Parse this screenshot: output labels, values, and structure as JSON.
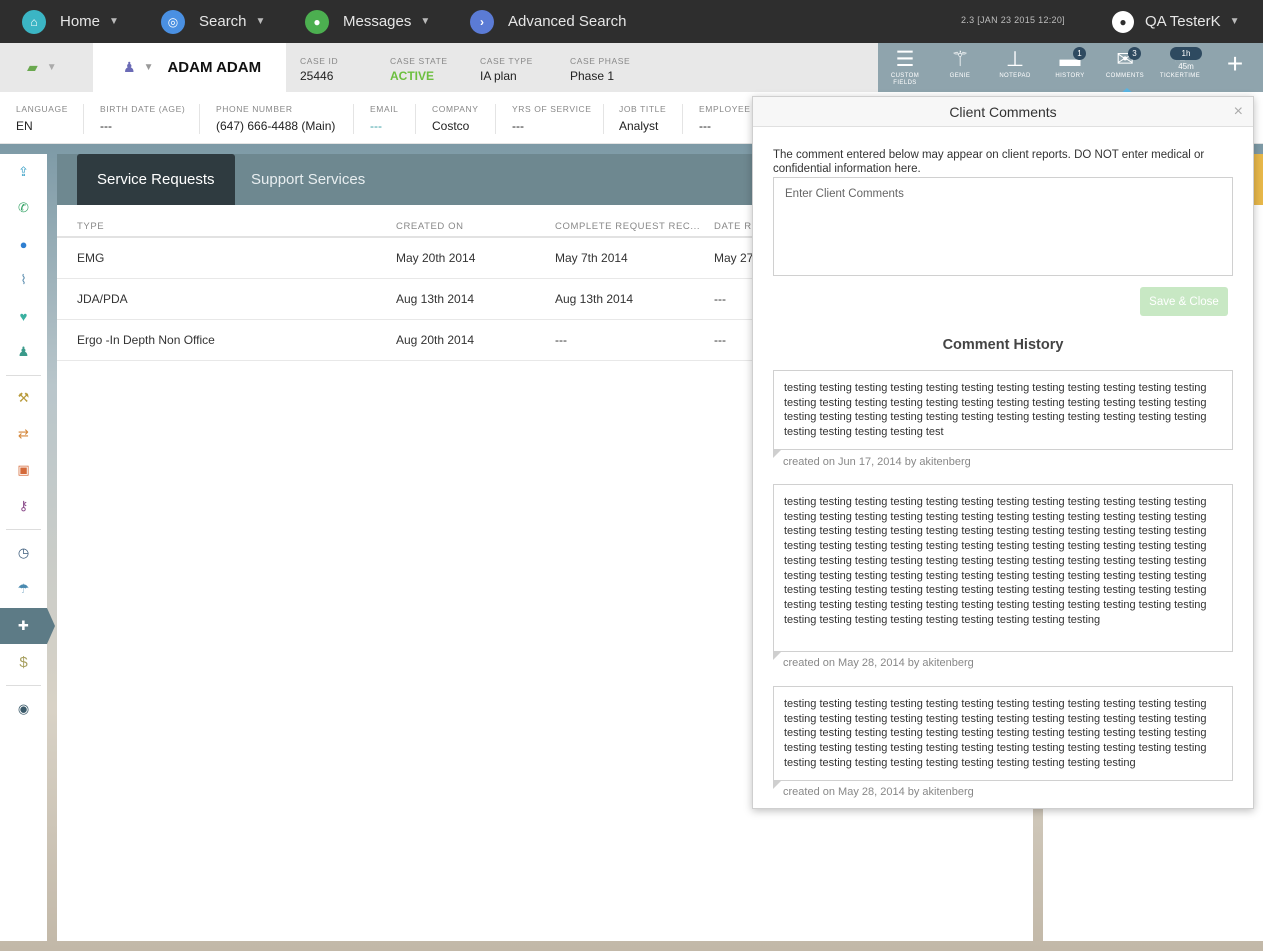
{
  "topnav": {
    "items": [
      {
        "label": "Home",
        "icon": "home-icon",
        "color": "#3bb5c4"
      },
      {
        "label": "Search",
        "icon": "search-icon",
        "color": "#4a90e2"
      },
      {
        "label": "Messages",
        "icon": "chat-icon",
        "color": "#4caf50"
      },
      {
        "label": "Advanced Search",
        "icon": "chevron-right-icon",
        "color": "#5b7bd5"
      }
    ],
    "version": "2.3 [JAN 23 2015 12:20]",
    "user": "QA TesterK"
  },
  "case": {
    "client_name": "ADAM ADAM",
    "fields": [
      {
        "label": "CASE ID",
        "value": "25446"
      },
      {
        "label": "CASE STATE",
        "value": "ACTIVE"
      },
      {
        "label": "CASE TYPE",
        "value": "IA plan"
      },
      {
        "label": "CASE PHASE",
        "value": "Phase 1"
      }
    ]
  },
  "toolbar": {
    "tools": [
      {
        "label": "CUSTOM FIELDS",
        "icon": "list-icon"
      },
      {
        "label": "GENIE",
        "icon": "wand-icon"
      },
      {
        "label": "NOTEPAD",
        "icon": "pin-icon"
      },
      {
        "label": "HISTORY",
        "icon": "folder-icon",
        "badge": "1"
      },
      {
        "label": "COMMENTS",
        "icon": "envelope-icon",
        "badge": "3"
      },
      {
        "label": "TICKERTIME",
        "icon": "timer-icon",
        "badge": "1h 45m"
      }
    ]
  },
  "info": {
    "fields": [
      {
        "label": "LANGUAGE",
        "value": "EN"
      },
      {
        "label": "BIRTH DATE (AGE)",
        "value": "---"
      },
      {
        "label": "PHONE NUMBER",
        "value": "(647) 666-4488 (Main)"
      },
      {
        "label": "EMAIL",
        "value": "---"
      },
      {
        "label": "COMPANY",
        "value": "Costco"
      },
      {
        "label": "YRS OF SERVICE",
        "value": "---"
      },
      {
        "label": "JOB TITLE",
        "value": "Analyst"
      },
      {
        "label": "EMPLOYEE I",
        "value": "---"
      }
    ]
  },
  "main": {
    "tabs": [
      "Service Requests",
      "Support Services"
    ],
    "columns": [
      "TYPE",
      "CREATED ON",
      "COMPLETE REQUEST REC...",
      "DATE RE"
    ],
    "rows": [
      [
        "EMG",
        "May 20th 2014",
        "May 7th 2014",
        "May 27"
      ],
      [
        "JDA/PDA",
        "Aug 13th 2014",
        "Aug 13th 2014",
        "---"
      ],
      [
        "Ergo -In Depth Non Office",
        "Aug 20th 2014",
        "---",
        "---"
      ]
    ]
  },
  "modal": {
    "title": "Client Comments",
    "close": "×",
    "notice": "The comment entered below may appear on client reports. DO NOT enter medical or confidential information here.",
    "placeholder": "Enter Client Comments",
    "save_label": "Save & Close",
    "history_title": "Comment History",
    "history": [
      {
        "text": "testing testing testing testing testing testing testing testing testing testing testing testing testing testing testing testing testing testing testing testing testing testing testing testing testing testing testing testing testing testing testing testing testing testing testing testing testing testing testing testing test",
        "meta": "created on Jun 17, 2014 by akitenberg"
      },
      {
        "text": "testing testing testing testing testing testing testing testing testing testing testing testing testing testing testing testing testing testing testing testing testing testing testing testing testing testing testing testing testing testing testing testing testing testing testing testing testing testing testing testing testing testing testing testing testing testing testing testing testing testing testing testing testing testing testing testing testing testing testing testing testing testing testing testing testing testing testing testing testing testing testing testing testing testing testing testing testing testing testing testing testing testing testing testing testing testing testing testing testing testing testing testing testing testing testing testing testing testing testing testing testing testing testing testing testing",
        "meta": "created on May 28, 2014 by akitenberg"
      },
      {
        "text": "testing testing testing testing testing testing testing testing testing testing testing testing testing testing testing testing testing testing testing testing testing testing testing testing testing testing testing testing testing testing testing testing testing testing testing testing testing testing testing testing testing testing testing testing testing testing testing testing testing testing testing testing testing testing testing testing testing testing",
        "meta": "created on May 28, 2014 by akitenberg"
      }
    ]
  }
}
